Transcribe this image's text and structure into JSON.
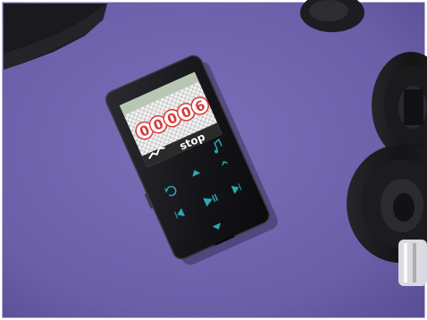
{
  "player": {
    "screen_digits": [
      "0",
      "0",
      "0",
      "0",
      "6"
    ],
    "button_label": "stop"
  },
  "colors": {
    "surface": "#6f63ad",
    "device_body": "#1b1b1f",
    "digit_red": "#d63a3a",
    "button_glow": "#2aa7b8"
  },
  "icons": [
    "music-note-icon",
    "back-icon",
    "menu-icon",
    "previous-icon",
    "play-pause-icon",
    "next-icon",
    "volume-down-icon",
    "volume-up-icon"
  ]
}
